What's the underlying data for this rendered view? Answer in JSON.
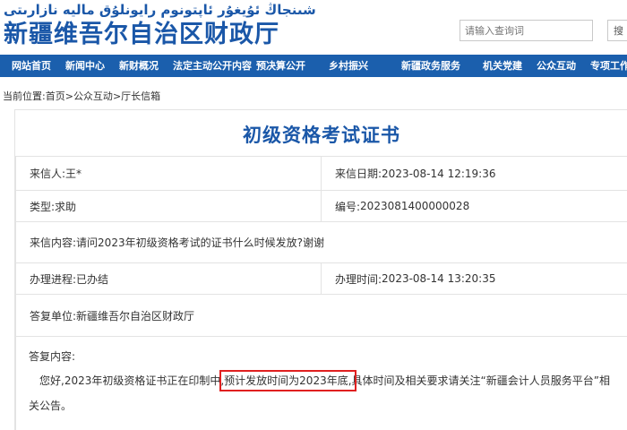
{
  "header": {
    "uyghur_title": "شىنجاڭ ئۇيغۇر ئاپتونوم رايونلۇق ماليە نازارىتى",
    "site_title": "新疆维吾尔自治区财政厅",
    "search_placeholder": "请输入查询词",
    "search_button": "搜"
  },
  "nav": {
    "items": [
      "网站首页",
      "新闻中心",
      "新财概况",
      "法定主动公开内容",
      "预决算公开",
      "乡村振兴",
      "新疆政务服务",
      "机关党建",
      "公众互动",
      "专项工作"
    ]
  },
  "breadcrumb": {
    "prefix": "当前位置:",
    "items": [
      "首页",
      "公众互动",
      "厅长信箱"
    ],
    "separator": ">"
  },
  "letter": {
    "title": "初级资格考试证书",
    "sender_label": "来信人:",
    "sender": "王*",
    "date_label": "来信日期:",
    "date": "2023-08-14 12:19:36",
    "type_label": "类型:",
    "type": "求助",
    "number_label": "编号:",
    "number": "2023081400000028",
    "content_label": "来信内容:",
    "content": "请问2023年初级资格考试的证书什么时候发放?谢谢",
    "status_label": "办理进程:",
    "status": "已办结",
    "handle_time_label": "办理时间:",
    "handle_time": "2023-08-14 13:20:35",
    "reply_unit_label": "答复单位:",
    "reply_unit": "新疆维吾尔自治区财政厅",
    "reply_label": "答复内容:",
    "reply_part1": "您好,2023年初级资格证书正在印制中,",
    "reply_highlight": "预计发放时间为2023年底,",
    "reply_part2": "具体时间及相关要求请关注“新疆会计人员服务平台”相关公告。"
  },
  "colors": {
    "brand_blue": "#1a57a8",
    "nav_blue": "#1b5fad",
    "highlight_red": "#e02020"
  }
}
